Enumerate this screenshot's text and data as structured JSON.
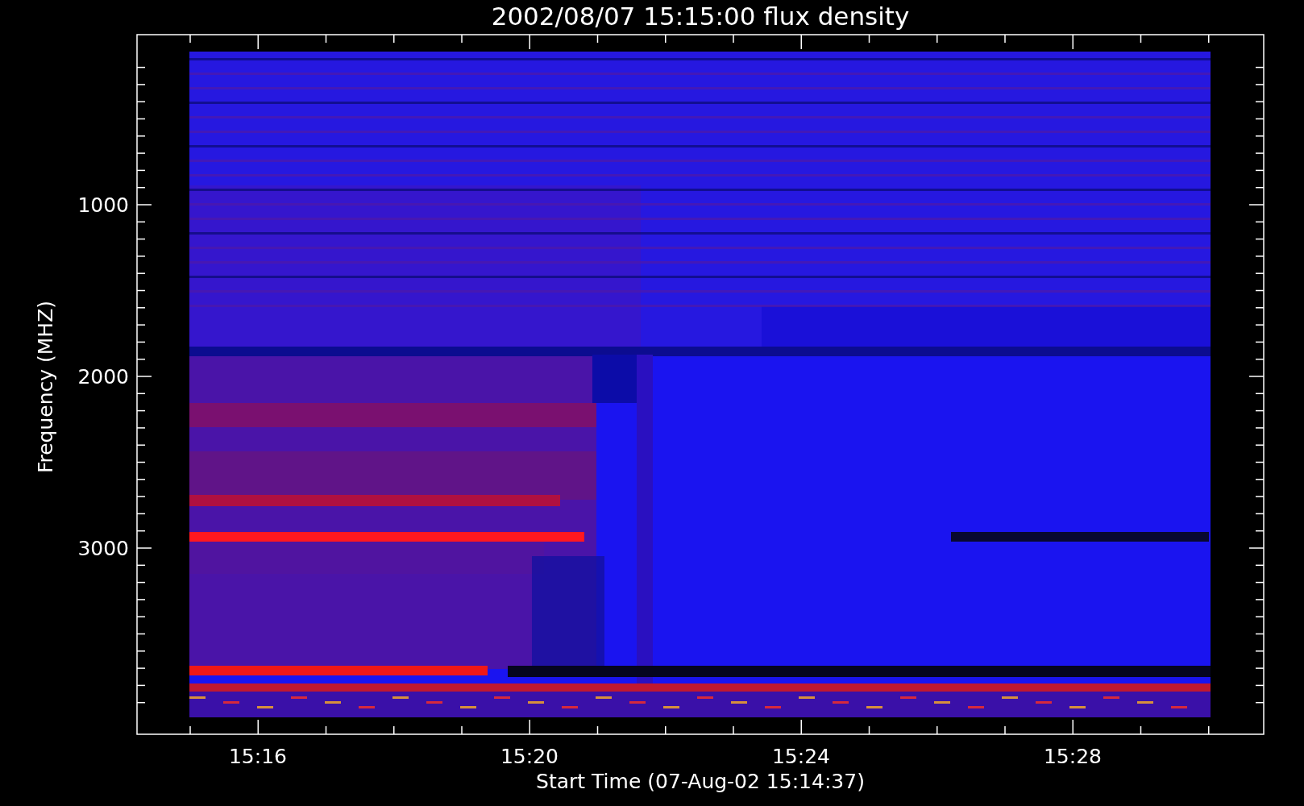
{
  "title": "2002/08/07 15:15:00 flux density",
  "x_axis": {
    "label": "Start Time (07-Aug-02 15:14:37)",
    "ticks": [
      "15:16",
      "15:20",
      "15:24",
      "15:28"
    ]
  },
  "y_axis": {
    "label": "Frequency (MHZ)",
    "ticks": [
      "1000",
      "2000",
      "3000"
    ]
  }
}
